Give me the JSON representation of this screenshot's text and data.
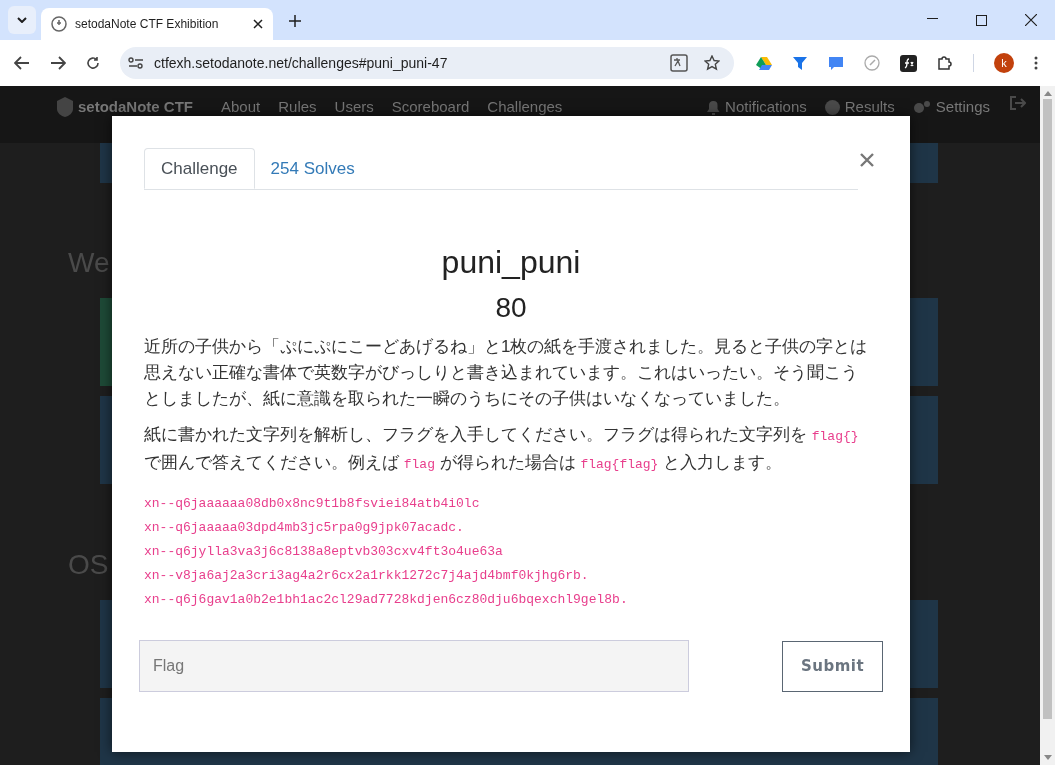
{
  "browser": {
    "tab_title": "setodaNote CTF Exhibition",
    "url": "ctfexh.setodanote.net/challenges#puni_puni-47",
    "profile_initial": "k"
  },
  "page": {
    "brand": "setodaNote CTF",
    "nav": [
      "About",
      "Rules",
      "Users",
      "Scoreboard",
      "Challenges"
    ],
    "nav_right": [
      {
        "kind": "bell",
        "label": "Notifications"
      },
      {
        "kind": "person",
        "label": "Results"
      },
      {
        "kind": "gear",
        "label": "Settings"
      }
    ],
    "headings": [
      "We",
      "OS"
    ]
  },
  "modal": {
    "tabs": [
      {
        "label": "Challenge",
        "selected": true
      },
      {
        "label": "254 Solves",
        "selected": false
      }
    ],
    "title": "puni_puni",
    "value": "80",
    "paragraphs": [
      [
        {
          "kind": "text",
          "text": "近所の子供から「ぷにぷにこーどあげるね」と1枚の紙を手渡されました。見ると子供の字とは思えない正確な書体で英数字がびっしりと書き込まれています。これはいったい。そう聞こうとしましたが、紙に意識を取られた一瞬のうちにその子供はいなくなっていました。"
        }
      ],
      [
        {
          "kind": "text",
          "text": "紙に書かれた文字列を解析し、フラグを入手してください。フラグは得られた文字列を "
        },
        {
          "kind": "code",
          "text": "flag{}"
        },
        {
          "kind": "text",
          "text": " で囲んで答えてください。例えば "
        },
        {
          "kind": "code",
          "text": "flag"
        },
        {
          "kind": "text",
          "text": " が得られた場合は "
        },
        {
          "kind": "code",
          "text": "flag{flag}"
        },
        {
          "kind": "text",
          "text": " と入力します。"
        }
      ]
    ],
    "code_lines": [
      "xn--q6jaaaaaa08db0x8nc9t1b8fsviei84atb4i0lc",
      "xn--q6jaaaaa03dpd4mb3jc5rpa0g9jpk07acadc.",
      "xn--q6jylla3va3j6c8138a8eptvb303cxv4ft3o4ue63a",
      "xn--v8ja6aj2a3cri3ag4a2r6cx2a1rkk1272c7j4ajd4bmf0kjhg6rb.",
      "xn--q6j6gav1a0b2e1bh1ac2cl29ad7728kdjen6cz80dju6bqexchl9gel8b."
    ],
    "flag_field": {
      "placeholder": "Flag"
    },
    "submit": "Submit"
  }
}
